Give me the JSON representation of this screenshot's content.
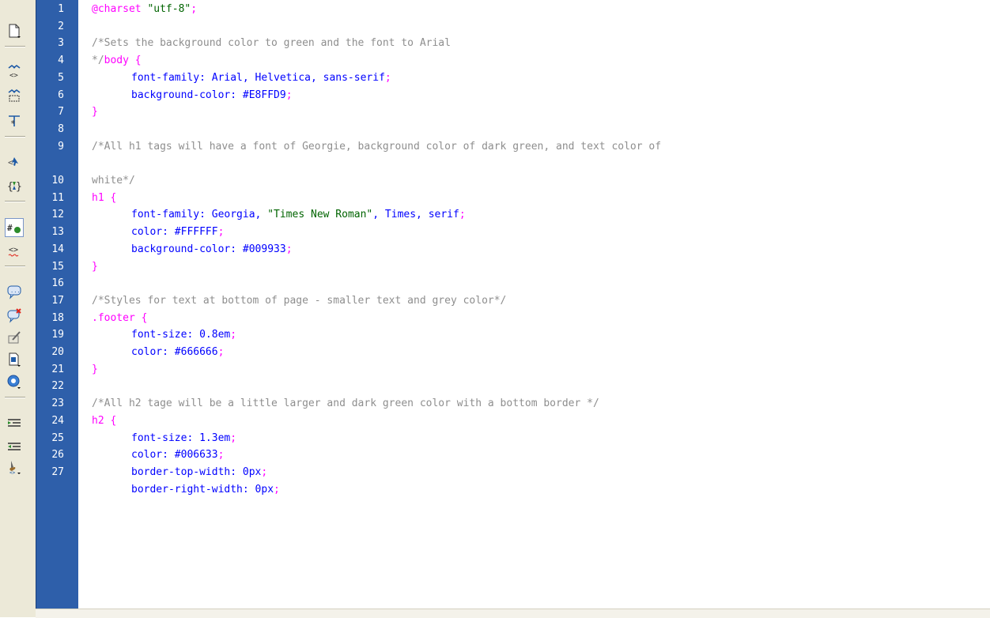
{
  "toolbar": {
    "icons": [
      "file-management-icon",
      "collapse-full-tag-icon",
      "collapse-selection-icon",
      "expand-all-icon",
      "select-parent-tag-icon",
      "balance-braces-icon",
      "line-numbers-icon",
      "highlight-invalid-code-icon",
      "apply-comment-icon",
      "remove-comment-icon",
      "wrap-tag-icon",
      "recent-snippets-icon",
      "move-css-icon",
      "indent-code-icon",
      "outdent-code-icon",
      "format-source-code-icon"
    ]
  },
  "editor": {
    "line_numbers": [
      "1",
      "2",
      "3",
      "4",
      "5",
      "6",
      "7",
      "8",
      "9",
      "10",
      "11",
      "12",
      "13",
      "14",
      "15",
      "16",
      "17",
      "18",
      "19",
      "20",
      "21",
      "22",
      "23",
      "24",
      "25",
      "26",
      "27"
    ],
    "lines": [
      [
        "@charset ",
        "\"utf-8\"",
        ";"
      ],
      [],
      [
        "/*Sets the background color to green and the font to Arial"
      ],
      [
        "*/",
        "body",
        " {"
      ],
      [
        "font-family",
        ": ",
        "Arial, Helvetica, sans-serif",
        ";"
      ],
      [
        "background-color",
        ": ",
        "#E8FFD9",
        ";"
      ],
      [
        "}"
      ],
      [],
      [
        "/*All h1 tags will have a font of Georgie, background color of dark green, and text color of"
      ],
      [
        "white*/"
      ],
      [
        "h1",
        " {"
      ],
      [
        "font-family",
        ": ",
        "Georgia, ",
        "\"Times New Roman\"",
        ", Times, serif",
        ";"
      ],
      [
        "color",
        ": ",
        "#FFFFFF",
        ";"
      ],
      [
        "background-color",
        ": ",
        "#009933",
        ";"
      ],
      [
        "}"
      ],
      [],
      [
        "/*Styles for text at bottom of page - smaller text and grey color*/"
      ],
      [
        ".footer",
        " {"
      ],
      [
        "font-size",
        ": ",
        "0.8em",
        ";"
      ],
      [
        "color",
        ": ",
        "#666666",
        ";"
      ],
      [
        "}"
      ],
      [],
      [
        "/*All h2 tage will be a little larger and dark green color with a bottom border */"
      ],
      [
        "h2",
        " {"
      ],
      [
        "font-size",
        ": ",
        "1.3em",
        ";"
      ],
      [
        "color",
        ": ",
        "#006633",
        ";"
      ],
      [
        "border-top-width",
        ": ",
        "0px",
        ";"
      ],
      [
        "border-right-width",
        ": ",
        "0px",
        ";"
      ]
    ]
  },
  "colors": {
    "gutter": "#2e5faa",
    "comment": "#8e8e8e",
    "selector": "#ff00ff",
    "property": "#0000ff",
    "string": "#006400",
    "toolbar_bg": "#ece9d8"
  }
}
